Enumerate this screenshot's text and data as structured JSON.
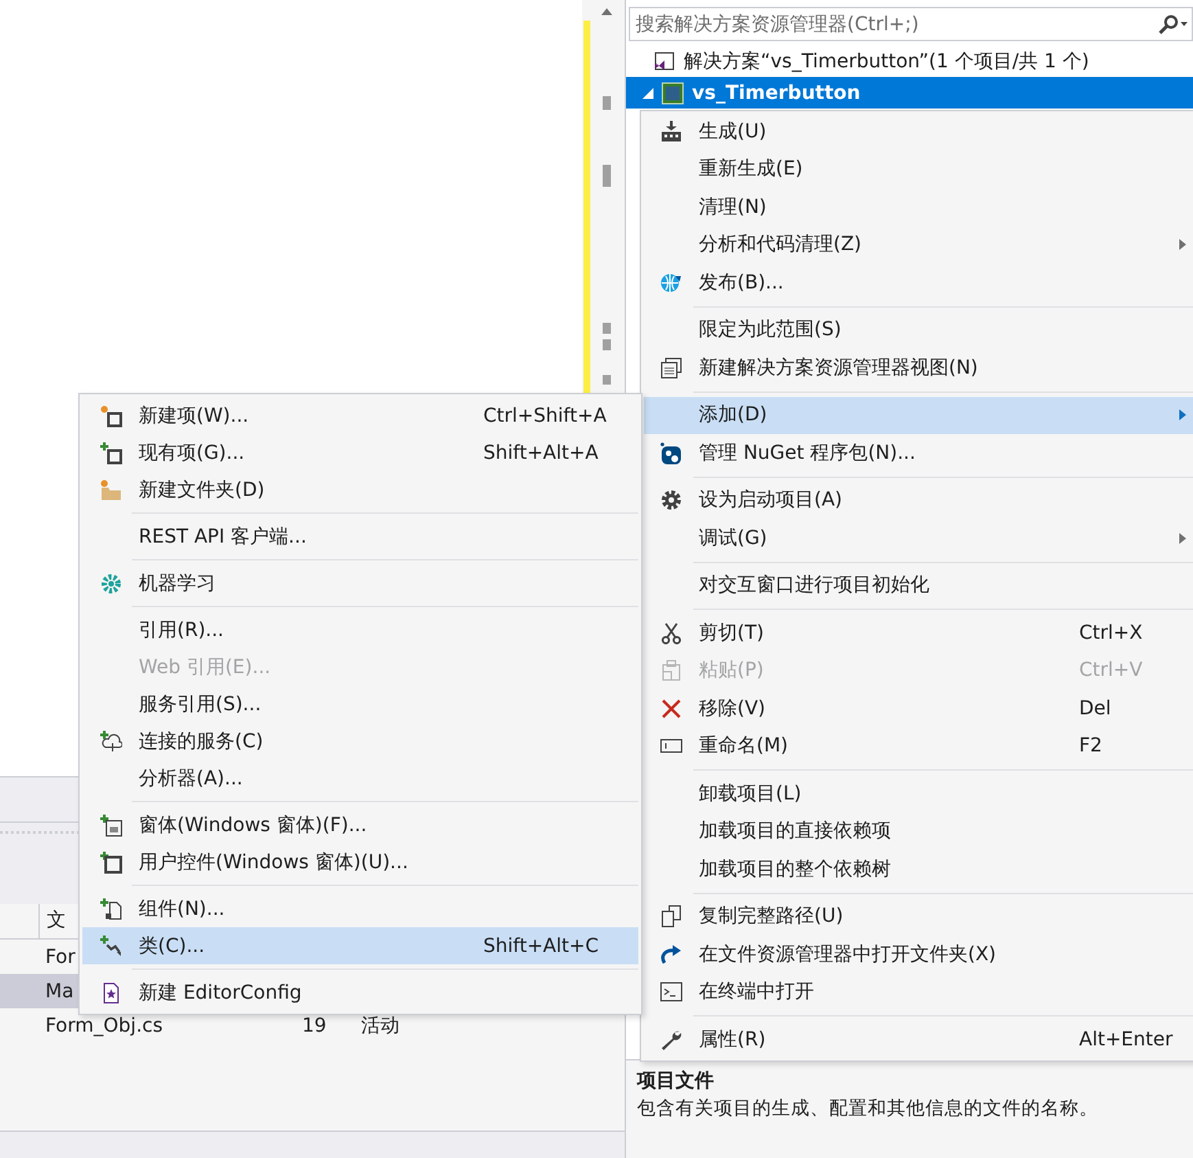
{
  "solution_explorer": {
    "search": {
      "placeholder": "搜索解决方案资源管理器(Ctrl+;)"
    },
    "tree": [
      {
        "label": "解决方案“vs_Timerbutton”(1 个项目/共 1 个)",
        "kind": "solution",
        "selected": false,
        "children": [
          {
            "label": "vs_Timerbutton",
            "kind": "project",
            "selected": true,
            "expanded": true
          }
        ]
      }
    ]
  },
  "context_menu": {
    "items": [
      {
        "kind": "item",
        "label": "生成(U)",
        "selected": false,
        "disabled": false,
        "submenu": false
      },
      {
        "kind": "item",
        "label": "重新生成(E)",
        "selected": false,
        "disabled": false,
        "submenu": false
      },
      {
        "kind": "item",
        "label": "清理(N)",
        "selected": false,
        "disabled": false,
        "submenu": false
      },
      {
        "kind": "item",
        "label": "分析和代码清理(Z)",
        "selected": false,
        "disabled": false,
        "submenu": true
      },
      {
        "kind": "item",
        "label": "发布(B)...",
        "selected": false,
        "disabled": false,
        "submenu": false
      },
      {
        "kind": "separator"
      },
      {
        "kind": "item",
        "label": "限定为此范围(S)",
        "selected": false,
        "disabled": false,
        "submenu": false
      },
      {
        "kind": "item",
        "label": "新建解决方案资源管理器视图(N)",
        "selected": false,
        "disabled": false,
        "submenu": false
      },
      {
        "kind": "separator"
      },
      {
        "kind": "item",
        "label": "添加(D)",
        "selected": true,
        "disabled": false,
        "submenu": true
      },
      {
        "kind": "item",
        "label": "管理 NuGet 程序包(N)...",
        "selected": false,
        "disabled": false,
        "submenu": false
      },
      {
        "kind": "separator"
      },
      {
        "kind": "item",
        "label": "设为启动项目(A)",
        "selected": false,
        "disabled": false,
        "submenu": false
      },
      {
        "kind": "item",
        "label": "调试(G)",
        "selected": false,
        "disabled": false,
        "submenu": true
      },
      {
        "kind": "separator"
      },
      {
        "kind": "item",
        "label": "对交互窗口进行项目初始化",
        "selected": false,
        "disabled": false,
        "submenu": false
      },
      {
        "kind": "separator"
      },
      {
        "kind": "item",
        "label": "剪切(T)",
        "shortcut": "Ctrl+X",
        "selected": false,
        "disabled": false,
        "submenu": false
      },
      {
        "kind": "item",
        "label": "粘贴(P)",
        "shortcut": "Ctrl+V",
        "selected": false,
        "disabled": true,
        "submenu": false
      },
      {
        "kind": "item",
        "label": "移除(V)",
        "shortcut": "Del",
        "selected": false,
        "disabled": false,
        "submenu": false
      },
      {
        "kind": "item",
        "label": "重命名(M)",
        "shortcut": "F2",
        "selected": false,
        "disabled": false,
        "submenu": false
      },
      {
        "kind": "separator"
      },
      {
        "kind": "item",
        "label": "卸载项目(L)",
        "selected": false,
        "disabled": false,
        "submenu": false
      },
      {
        "kind": "item",
        "label": "加载项目的直接依赖项",
        "selected": false,
        "disabled": false,
        "submenu": false
      },
      {
        "kind": "item",
        "label": "加载项目的整个依赖树",
        "selected": false,
        "disabled": false,
        "submenu": false
      },
      {
        "kind": "separator"
      },
      {
        "kind": "item",
        "label": "复制完整路径(U)",
        "selected": false,
        "disabled": false,
        "submenu": false
      },
      {
        "kind": "item",
        "label": "在文件资源管理器中打开文件夹(X)",
        "selected": false,
        "disabled": false,
        "submenu": false
      },
      {
        "kind": "item",
        "label": "在终端中打开",
        "selected": false,
        "disabled": false,
        "submenu": false
      },
      {
        "kind": "separator"
      },
      {
        "kind": "item",
        "label": "属性(R)",
        "shortcut": "Alt+Enter",
        "selected": false,
        "disabled": false,
        "submenu": false
      }
    ]
  },
  "add_submenu": {
    "items": [
      {
        "kind": "item",
        "label": "新建项(W)...",
        "shortcut": "Ctrl+Shift+A",
        "selected": false,
        "disabled": false
      },
      {
        "kind": "item",
        "label": "现有项(G)...",
        "shortcut": "Shift+Alt+A",
        "selected": false,
        "disabled": false
      },
      {
        "kind": "item",
        "label": "新建文件夹(D)",
        "selected": false,
        "disabled": false
      },
      {
        "kind": "separator"
      },
      {
        "kind": "item",
        "label": "REST API 客户端...",
        "selected": false,
        "disabled": false
      },
      {
        "kind": "separator"
      },
      {
        "kind": "item",
        "label": "机器学习",
        "selected": false,
        "disabled": false
      },
      {
        "kind": "separator"
      },
      {
        "kind": "item",
        "label": "引用(R)...",
        "selected": false,
        "disabled": false
      },
      {
        "kind": "item",
        "label": "Web 引用(E)...",
        "selected": false,
        "disabled": true
      },
      {
        "kind": "item",
        "label": "服务引用(S)...",
        "selected": false,
        "disabled": false
      },
      {
        "kind": "item",
        "label": "连接的服务(C)",
        "selected": false,
        "disabled": false
      },
      {
        "kind": "item",
        "label": "分析器(A)...",
        "selected": false,
        "disabled": false
      },
      {
        "kind": "separator"
      },
      {
        "kind": "item",
        "label": "窗体(Windows 窗体)(F)...",
        "selected": false,
        "disabled": false
      },
      {
        "kind": "item",
        "label": "用户控件(Windows 窗体)(U)...",
        "selected": false,
        "disabled": false
      },
      {
        "kind": "separator"
      },
      {
        "kind": "item",
        "label": "组件(N)...",
        "selected": false,
        "disabled": false
      },
      {
        "kind": "item",
        "label": "类(C)...",
        "shortcut": "Shift+Alt+C",
        "selected": true,
        "disabled": false
      },
      {
        "kind": "separator"
      },
      {
        "kind": "item",
        "label": "新建 EditorConfig",
        "selected": false,
        "disabled": false
      }
    ]
  },
  "file_table": {
    "columns": [
      "文"
    ],
    "rows": [
      {
        "cells": [
          "For"
        ],
        "selected": false
      },
      {
        "cells": [
          "Ma"
        ],
        "selected": true
      },
      {
        "cells": [
          "Form_Obj.cs",
          "19",
          "活动"
        ],
        "selected": false
      }
    ]
  },
  "description": {
    "title": "项目文件",
    "text": "包含有关项目的生成、配置和其他信息的文件的名称。"
  }
}
